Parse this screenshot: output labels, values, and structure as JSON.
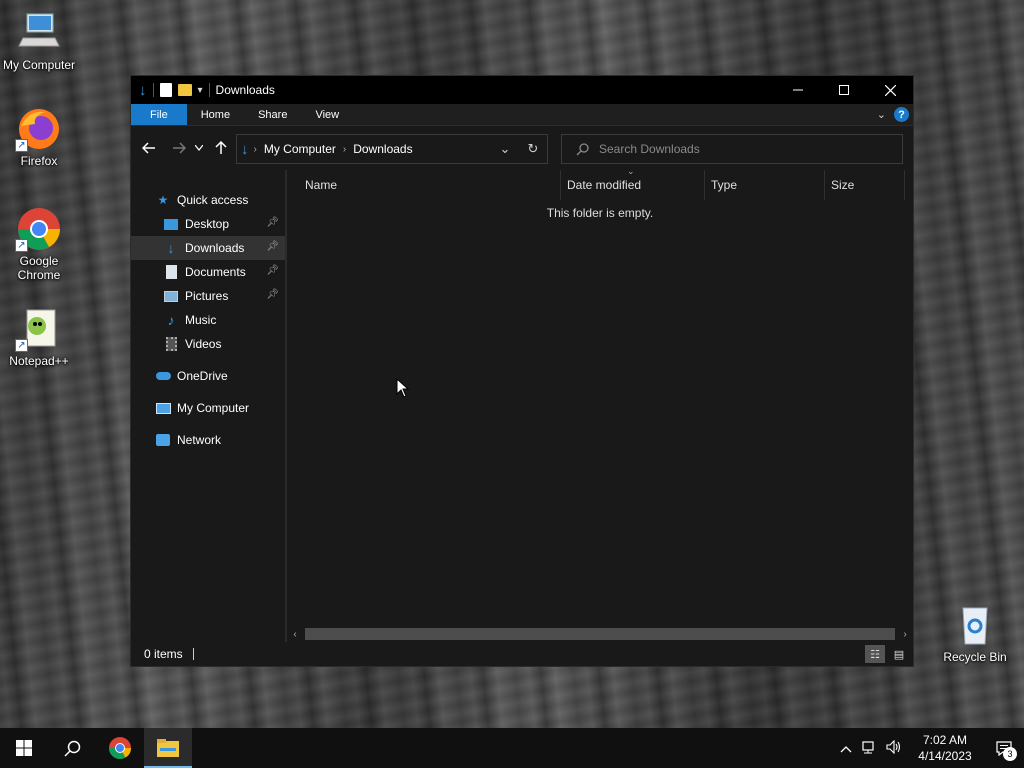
{
  "desktop": {
    "icons": [
      {
        "label": "My Computer",
        "icon": "computer-icon"
      },
      {
        "label": "Firefox",
        "icon": "firefox-icon"
      },
      {
        "label": "Google Chrome",
        "icon": "chrome-icon"
      },
      {
        "label": "Notepad++",
        "icon": "notepadplusplus-icon"
      },
      {
        "label": "Recycle Bin",
        "icon": "recycle-bin-icon"
      }
    ]
  },
  "window": {
    "title": "Downloads",
    "ribbon_tabs": [
      "File",
      "Home",
      "Share",
      "View"
    ],
    "breadcrumb": [
      "My Computer",
      "Downloads"
    ],
    "search_placeholder": "Search Downloads",
    "nav_pane": {
      "quick_access": "Quick access",
      "items": [
        {
          "label": "Desktop",
          "pinned": true
        },
        {
          "label": "Downloads",
          "pinned": true,
          "selected": true
        },
        {
          "label": "Documents",
          "pinned": true
        },
        {
          "label": "Pictures",
          "pinned": true
        },
        {
          "label": "Music",
          "pinned": false
        },
        {
          "label": "Videos",
          "pinned": false
        }
      ],
      "onedrive": "OneDrive",
      "this_pc": "My Computer",
      "network": "Network"
    },
    "columns": [
      "Name",
      "Date modified",
      "Type",
      "Size"
    ],
    "empty_message": "This folder is empty.",
    "status": "0 items"
  },
  "taskbar": {
    "time": "7:02 AM",
    "date": "4/14/2023",
    "notification_count": "3"
  },
  "colors": {
    "accent": "#1979ca",
    "window_bg": "#191919",
    "taskbar_bg": "#101010"
  }
}
